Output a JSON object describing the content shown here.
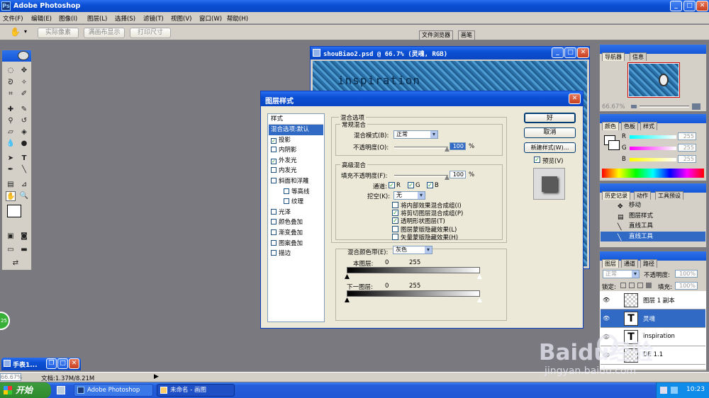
{
  "app": {
    "title": "Adobe Photoshop"
  },
  "menu": [
    "文件(F)",
    "编辑(E)",
    "图像(I)",
    "图层(L)",
    "选择(S)",
    "滤镜(T)",
    "视图(V)",
    "窗口(W)",
    "帮助(H)"
  ],
  "optionsbar": {
    "btn1": "实际像素",
    "btn2": "满画布显示",
    "btn3": "打印尺寸",
    "well_tab1": "文件浏览器",
    "well_tab2": "画笔"
  },
  "doc": {
    "title": "shouBiao2.psd @ 66.7% (灵魂, RGB)",
    "canvas_text": "inspiration"
  },
  "dialog": {
    "title": "图层样式",
    "styles_header": "样式",
    "styles": [
      {
        "label": "混合选项:默认",
        "checked": null,
        "selected": true,
        "indent": false
      },
      {
        "label": "投影",
        "checked": true,
        "selected": false,
        "indent": false
      },
      {
        "label": "内阴影",
        "checked": false,
        "selected": false,
        "indent": false
      },
      {
        "label": "外发光",
        "checked": true,
        "selected": false,
        "indent": false
      },
      {
        "label": "内发光",
        "checked": false,
        "selected": false,
        "indent": false
      },
      {
        "label": "斜面和浮雕",
        "checked": false,
        "selected": false,
        "indent": false
      },
      {
        "label": "等高线",
        "checked": false,
        "selected": false,
        "indent": true
      },
      {
        "label": "纹理",
        "checked": false,
        "selected": false,
        "indent": true
      },
      {
        "label": "光泽",
        "checked": false,
        "selected": false,
        "indent": false
      },
      {
        "label": "颜色叠加",
        "checked": false,
        "selected": false,
        "indent": false
      },
      {
        "label": "渐变叠加",
        "checked": false,
        "selected": false,
        "indent": false
      },
      {
        "label": "图案叠加",
        "checked": false,
        "selected": false,
        "indent": false
      },
      {
        "label": "描边",
        "checked": false,
        "selected": false,
        "indent": false
      }
    ],
    "blend": {
      "group": "混合选项",
      "general": "常规混合",
      "mode_label": "混合模式(B):",
      "mode_value": "正常",
      "opacity_label": "不透明度(O):",
      "opacity_value": "100",
      "pct": "%",
      "advanced": "高级混合",
      "fill_label": "填充不透明度(F):",
      "fill_value": "100",
      "channels_label": "通道:",
      "ch_r": "R",
      "ch_g": "G",
      "ch_b": "B",
      "knockout_label": "挖空(K):",
      "knockout_value": "无",
      "options": [
        {
          "label": "将内部效果混合成组(I)",
          "checked": false
        },
        {
          "label": "将剪切图层混合成组(P)",
          "checked": true
        },
        {
          "label": "透明形状图层(T)",
          "checked": true
        },
        {
          "label": "图层蒙版隐藏效果(L)",
          "checked": false
        },
        {
          "label": "矢量蒙版隐藏效果(H)",
          "checked": false
        }
      ],
      "blendif_label": "混合颜色带(E):",
      "blendif_value": "灰色",
      "this_layer": "本图层:",
      "this_low": "0",
      "this_high": "255",
      "under_layer": "下一图层:",
      "under_low": "0",
      "under_high": "255"
    },
    "ok": "好",
    "cancel": "取消",
    "new_style": "新建样式(W)...",
    "preview": "预览(V)"
  },
  "navigator": {
    "tab1": "导航器",
    "tab2": "信息",
    "zoom": "66.67%"
  },
  "color": {
    "tab1": "颜色",
    "tab2": "色板",
    "tab3": "样式",
    "r_label": "R",
    "g_label": "G",
    "b_label": "B",
    "r": "255",
    "g": "255",
    "b": "255"
  },
  "history": {
    "tab1": "历史记录",
    "tab2": "动作",
    "tab3": "工具预设",
    "items": [
      "移动",
      "图层样式",
      "直线工具",
      "直线工具"
    ]
  },
  "layers": {
    "tab1": "图层",
    "tab2": "通道",
    "tab3": "路径",
    "mode": "正常",
    "opacity_label": "不透明度:",
    "opacity": "100%",
    "lock_label": "锁定:",
    "fill_label": "填充:",
    "fill": "100%",
    "items": [
      {
        "name": "图层 1 副本",
        "type": "img",
        "selected": false
      },
      {
        "name": "灵魂",
        "type": "T",
        "selected": true
      },
      {
        "name": "inspiration",
        "type": "T",
        "selected": false
      },
      {
        "name": "DE 1.1",
        "type": "img",
        "selected": false
      }
    ]
  },
  "minidoc": {
    "title": "手表1..."
  },
  "status": {
    "zoom": "66.67%",
    "doc": "文档:1.37M/8.21M"
  },
  "taskbar": {
    "start": "开始",
    "task1": "Adobe Photoshop",
    "task2": "未命名 - 画图",
    "clock": "10:23"
  },
  "watermark": {
    "line1": "Baidu经验",
    "line2": "jingyan.baidu.com"
  },
  "float_badge": "25"
}
